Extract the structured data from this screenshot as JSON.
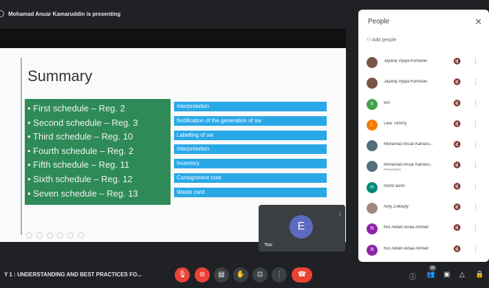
{
  "banner": {
    "presenting": "Mohamad Anuar Kamaruddin is presenting"
  },
  "slide": {
    "title": "Summary",
    "schedules": [
      "• First schedule – Reg. 2",
      "• Second schedule – Reg. 3",
      "• Third schedule – Reg. 10",
      "• Fourth schedule – Reg. 2",
      "• Fifth schedule – Reg. 11",
      "• Sixth schedule – Reg. 12",
      "• Seven schedule – Reg. 13"
    ],
    "boxes": [
      "Interpretation",
      "Notification of the generation of sw",
      "Labelling of sw",
      "Interpretation",
      "Inventory",
      "Consignment note",
      "Waste card"
    ]
  },
  "self_tile": {
    "initial": "E",
    "label": "You"
  },
  "people": {
    "title": "People",
    "add_label": "Add people",
    "list": [
      {
        "name": "Jayaraj Vijaya Kumaran",
        "sub": "",
        "initial": "",
        "color": "#795548"
      },
      {
        "name": "Jayaraj Vijaya Kumaran",
        "sub": "",
        "initial": "",
        "color": "#795548"
      },
      {
        "name": "kim",
        "sub": "",
        "initial": "k",
        "color": "#43a047"
      },
      {
        "name": "Liew Tommy",
        "sub": "",
        "initial": "L",
        "color": "#f57c00"
      },
      {
        "name": "Mohamad Anuar Kamaru...",
        "sub": "",
        "initial": "",
        "color": "#546e7a"
      },
      {
        "name": "Mohamad Anuar Kamaru...",
        "sub": "Presentation",
        "initial": "",
        "color": "#546e7a"
      },
      {
        "name": "mohd asimi",
        "sub": "",
        "initial": "m",
        "color": "#00897b"
      },
      {
        "name": "Noly Zulkeply",
        "sub": "",
        "initial": "",
        "color": "#a1887f"
      },
      {
        "name": "Nur Adilah Ainaa Ahmad",
        "sub": "",
        "initial": "N",
        "color": "#8e24aa"
      },
      {
        "name": "Nur Adilah Ainaa Ahmad",
        "sub": "",
        "initial": "N",
        "color": "#8e24aa"
      }
    ]
  },
  "bottom": {
    "meeting_title": "Y 1 : UNDERSTANDING AND BEST PRACTICES FO...",
    "people_count": "33"
  }
}
